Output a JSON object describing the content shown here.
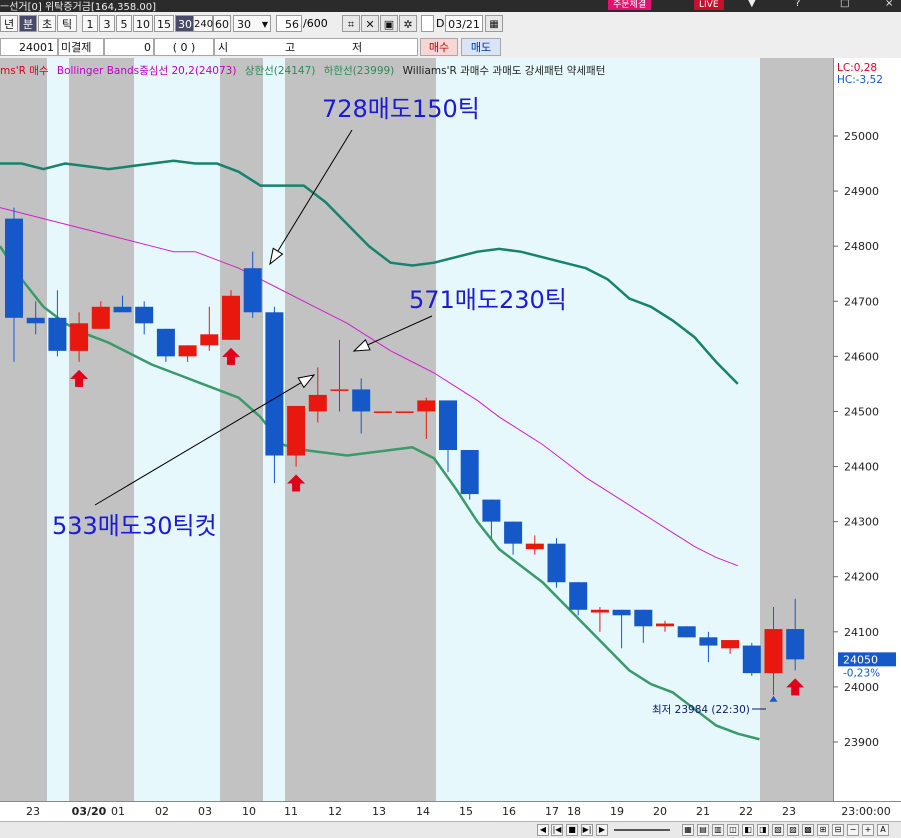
{
  "titlebar": {
    "left_text": "ㅡ선거[0]  위탁증거금[164,358.00]",
    "badge1": "주문체결",
    "badge2": "LIVE",
    "window_controls": [
      "▼",
      "?",
      "□",
      "×"
    ]
  },
  "toolbar": {
    "period_tabs": [
      "년",
      "분",
      "초",
      "틱"
    ],
    "selected_tab": "분",
    "intervals": [
      "1",
      "3",
      "5",
      "10",
      "15",
      "30",
      "240",
      "60"
    ],
    "selected_interval": "30",
    "interval_select": "30",
    "count": "56",
    "count_total": "/600",
    "date_checkbox_label": "D",
    "date_value": "03/21"
  },
  "infobar": {
    "price": "24001",
    "unfilled_label": "미결제",
    "unfilled_value": "0",
    "paren_value": "(   0   )",
    "market_chars": [
      "시",
      "고",
      "저"
    ],
    "buy_button": "매수",
    "sell_button": "매도"
  },
  "legend": [
    {
      "text": "ms'R 매수",
      "color": "#e0001a"
    },
    {
      "text": "Bollinger Bands중심선 20,2(24073)",
      "color": "#c000c0"
    },
    {
      "text": "상한선(24147)",
      "color": "#2e8b57"
    },
    {
      "text": "하한선(23999)",
      "color": "#2e8b57"
    },
    {
      "text": "Williams'R 과매수 과매도 강세패턴  약세패턴",
      "color": "#222222"
    }
  ],
  "indicators": {
    "lc": "LC:0,28",
    "hc": "HC:-3,52"
  },
  "colors": {
    "up_candle": "#e8180e",
    "down_candle": "#1558c8",
    "upper_band": "#17836c",
    "lower_band": "#3a9a6a",
    "middle_band": "#d020c8",
    "shade_gray": "#c2c2c2",
    "shade_cyan": "#e6f8fc",
    "annotation_text": "#1a1ad8"
  },
  "chart_data": {
    "type": "candlestick",
    "x_labels": [
      "23",
      "03/20",
      "01",
      "02",
      "03",
      "10",
      "11",
      "12",
      "13",
      "14",
      "15",
      "16",
      "17",
      "18",
      "19",
      "20",
      "21",
      "22",
      "23",
      "23:00:00"
    ],
    "ylim": [
      23800,
      25200
    ],
    "y_ticks": [
      23900,
      24000,
      24100,
      24200,
      24300,
      24400,
      24500,
      24600,
      24700,
      24800,
      24900,
      25000
    ],
    "candles": [
      {
        "o": 24850,
        "h": 24870,
        "l": 24590,
        "c": 24670
      },
      {
        "o": 24670,
        "h": 24700,
        "l": 24640,
        "c": 24660
      },
      {
        "o": 24670,
        "h": 24720,
        "l": 24600,
        "c": 24610
      },
      {
        "o": 24610,
        "h": 24680,
        "l": 24590,
        "c": 24660
      },
      {
        "o": 24650,
        "h": 24700,
        "l": 24650,
        "c": 24690
      },
      {
        "o": 24690,
        "h": 24710,
        "l": 24680,
        "c": 24680
      },
      {
        "o": 24690,
        "h": 24700,
        "l": 24640,
        "c": 24660
      },
      {
        "o": 24650,
        "h": 24650,
        "l": 24590,
        "c": 24600
      },
      {
        "o": 24600,
        "h": 24620,
        "l": 24590,
        "c": 24620
      },
      {
        "o": 24620,
        "h": 24690,
        "l": 24610,
        "c": 24640
      },
      {
        "o": 24630,
        "h": 24720,
        "l": 24630,
        "c": 24710
      },
      {
        "o": 24760,
        "h": 24790,
        "l": 24670,
        "c": 24680
      },
      {
        "o": 24680,
        "h": 24690,
        "l": 24370,
        "c": 24420
      },
      {
        "o": 24420,
        "h": 24510,
        "l": 24400,
        "c": 24510
      },
      {
        "o": 24500,
        "h": 24580,
        "l": 24480,
        "c": 24530
      },
      {
        "o": 24540,
        "h": 24630,
        "l": 24500,
        "c": 24540
      },
      {
        "o": 24540,
        "h": 24560,
        "l": 24460,
        "c": 24500
      },
      {
        "o": 24500,
        "h": 24500,
        "l": 24500,
        "c": 24500
      },
      {
        "o": 24500,
        "h": 24500,
        "l": 24500,
        "c": 24500
      },
      {
        "o": 24500,
        "h": 24525,
        "l": 24450,
        "c": 24520
      },
      {
        "o": 24520,
        "h": 24520,
        "l": 24390,
        "c": 24430
      },
      {
        "o": 24430,
        "h": 24430,
        "l": 24340,
        "c": 24350
      },
      {
        "o": 24340,
        "h": 24340,
        "l": 24270,
        "c": 24300
      },
      {
        "o": 24300,
        "h": 24300,
        "l": 24240,
        "c": 24260
      },
      {
        "o": 24250,
        "h": 24275,
        "l": 24240,
        "c": 24260
      },
      {
        "o": 24260,
        "h": 24270,
        "l": 24180,
        "c": 24190
      },
      {
        "o": 24190,
        "h": 24190,
        "l": 24130,
        "c": 24140
      },
      {
        "o": 24135,
        "h": 24145,
        "l": 24100,
        "c": 24140
      },
      {
        "o": 24140,
        "h": 24140,
        "l": 24070,
        "c": 24130
      },
      {
        "o": 24140,
        "h": 24140,
        "l": 24080,
        "c": 24110
      },
      {
        "o": 24110,
        "h": 24120,
        "l": 24100,
        "c": 24115
      },
      {
        "o": 24110,
        "h": 24110,
        "l": 24090,
        "c": 24090
      },
      {
        "o": 24090,
        "h": 24100,
        "l": 24045,
        "c": 24075
      },
      {
        "o": 24070,
        "h": 24085,
        "l": 24060,
        "c": 24085
      },
      {
        "o": 24075,
        "h": 24080,
        "l": 24020,
        "c": 24025
      },
      {
        "o": 24025,
        "h": 24145,
        "l": 23985,
        "c": 24105
      },
      {
        "o": 24105,
        "h": 24160,
        "l": 24030,
        "c": 24050
      }
    ],
    "upper_band": [
      24950,
      24950,
      24940,
      24950,
      24945,
      24940,
      24945,
      24950,
      24955,
      24950,
      24950,
      24935,
      24910,
      24910,
      24910,
      24880,
      24840,
      24800,
      24770,
      24765,
      24770,
      24780,
      24790,
      24795,
      24790,
      24780,
      24770,
      24760,
      24740,
      24705,
      24690,
      24665,
      24635,
      24590,
      24550
    ],
    "middle_band": [
      24870,
      24860,
      24850,
      24840,
      24830,
      24820,
      24810,
      24800,
      24790,
      24790,
      24775,
      24760,
      24740,
      24720,
      24700,
      24680,
      24660,
      24635,
      24610,
      24590,
      24570,
      24545,
      24520,
      24490,
      24465,
      24440,
      24410,
      24380,
      24355,
      24330,
      24305,
      24280,
      24255,
      24235,
      24220
    ],
    "lower_band": [
      24800,
      24740,
      24690,
      24660,
      24640,
      24625,
      24605,
      24585,
      24570,
      24555,
      24540,
      24525,
      24490,
      24440,
      24430,
      24425,
      24420,
      24425,
      24430,
      24435,
      24415,
      24360,
      24300,
      24250,
      24220,
      24190,
      24150,
      24110,
      24070,
      24030,
      24005,
      23990,
      23960,
      23930,
      23915,
      23905
    ],
    "buy_arrows": [
      3,
      10,
      13,
      36
    ],
    "annotations": [
      {
        "text": "728매도150틱",
        "target_candle": 11,
        "target_price": 24760
      },
      {
        "text": "571매도230틱",
        "target_candle": 15,
        "target_price": 24630
      },
      {
        "text": "533매도30틱컷",
        "target_candle": 14,
        "target_price": 24580
      }
    ],
    "min_label": "최저 23984 (22:30)",
    "current_price": "24050",
    "current_change": "-0,23%"
  }
}
